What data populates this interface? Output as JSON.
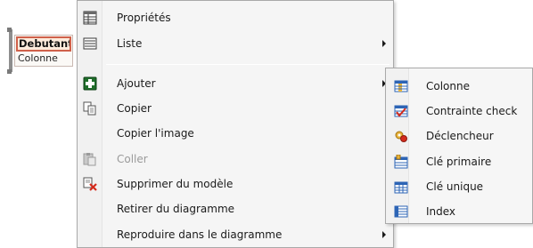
{
  "entity": {
    "name": "Debutant",
    "column": "Colonne",
    "border_color": "#d0614a",
    "fill_color": "#fdebdc"
  },
  "context_menu": {
    "items": [
      {
        "label": "Propriétés",
        "icon": "table-properties-icon",
        "enabled": true,
        "submenu": false
      },
      {
        "label": "Liste",
        "icon": "list-icon",
        "enabled": true,
        "submenu": true
      },
      {
        "label": "Ajouter",
        "icon": "add-green-plus-icon",
        "enabled": true,
        "submenu": true,
        "highlighted": true
      },
      {
        "label": "Copier",
        "icon": "copy-icon",
        "enabled": true,
        "submenu": false
      },
      {
        "label": "Copier l'image",
        "icon": "",
        "enabled": true,
        "submenu": false
      },
      {
        "label": "Coller",
        "icon": "paste-icon",
        "enabled": false,
        "submenu": false
      },
      {
        "label": "Supprimer du modèle",
        "icon": "delete-red-x-icon",
        "enabled": true,
        "submenu": false
      },
      {
        "label": "Retirer du diagramme",
        "icon": "",
        "enabled": true,
        "submenu": false
      },
      {
        "label": "Reproduire dans le diagramme",
        "icon": "",
        "enabled": true,
        "submenu": true
      }
    ]
  },
  "submenu": {
    "parent": "Ajouter",
    "items": [
      {
        "label": "Colonne",
        "icon": "column-icon"
      },
      {
        "label": "Contrainte check",
        "icon": "check-constraint-icon"
      },
      {
        "label": "Déclencheur",
        "icon": "trigger-icon"
      },
      {
        "label": "Clé primaire",
        "icon": "primary-key-icon"
      },
      {
        "label": "Clé unique",
        "icon": "unique-key-icon"
      },
      {
        "label": "Index",
        "icon": "index-icon"
      }
    ]
  },
  "colors": {
    "menu_bg": "#f5f5f5",
    "menu_border": "#a9a9a9",
    "disabled_text": "#9a9a9a",
    "icon_blue": "#2c64b5",
    "icon_green": "#2e8b2e",
    "icon_red": "#d42a1c"
  }
}
